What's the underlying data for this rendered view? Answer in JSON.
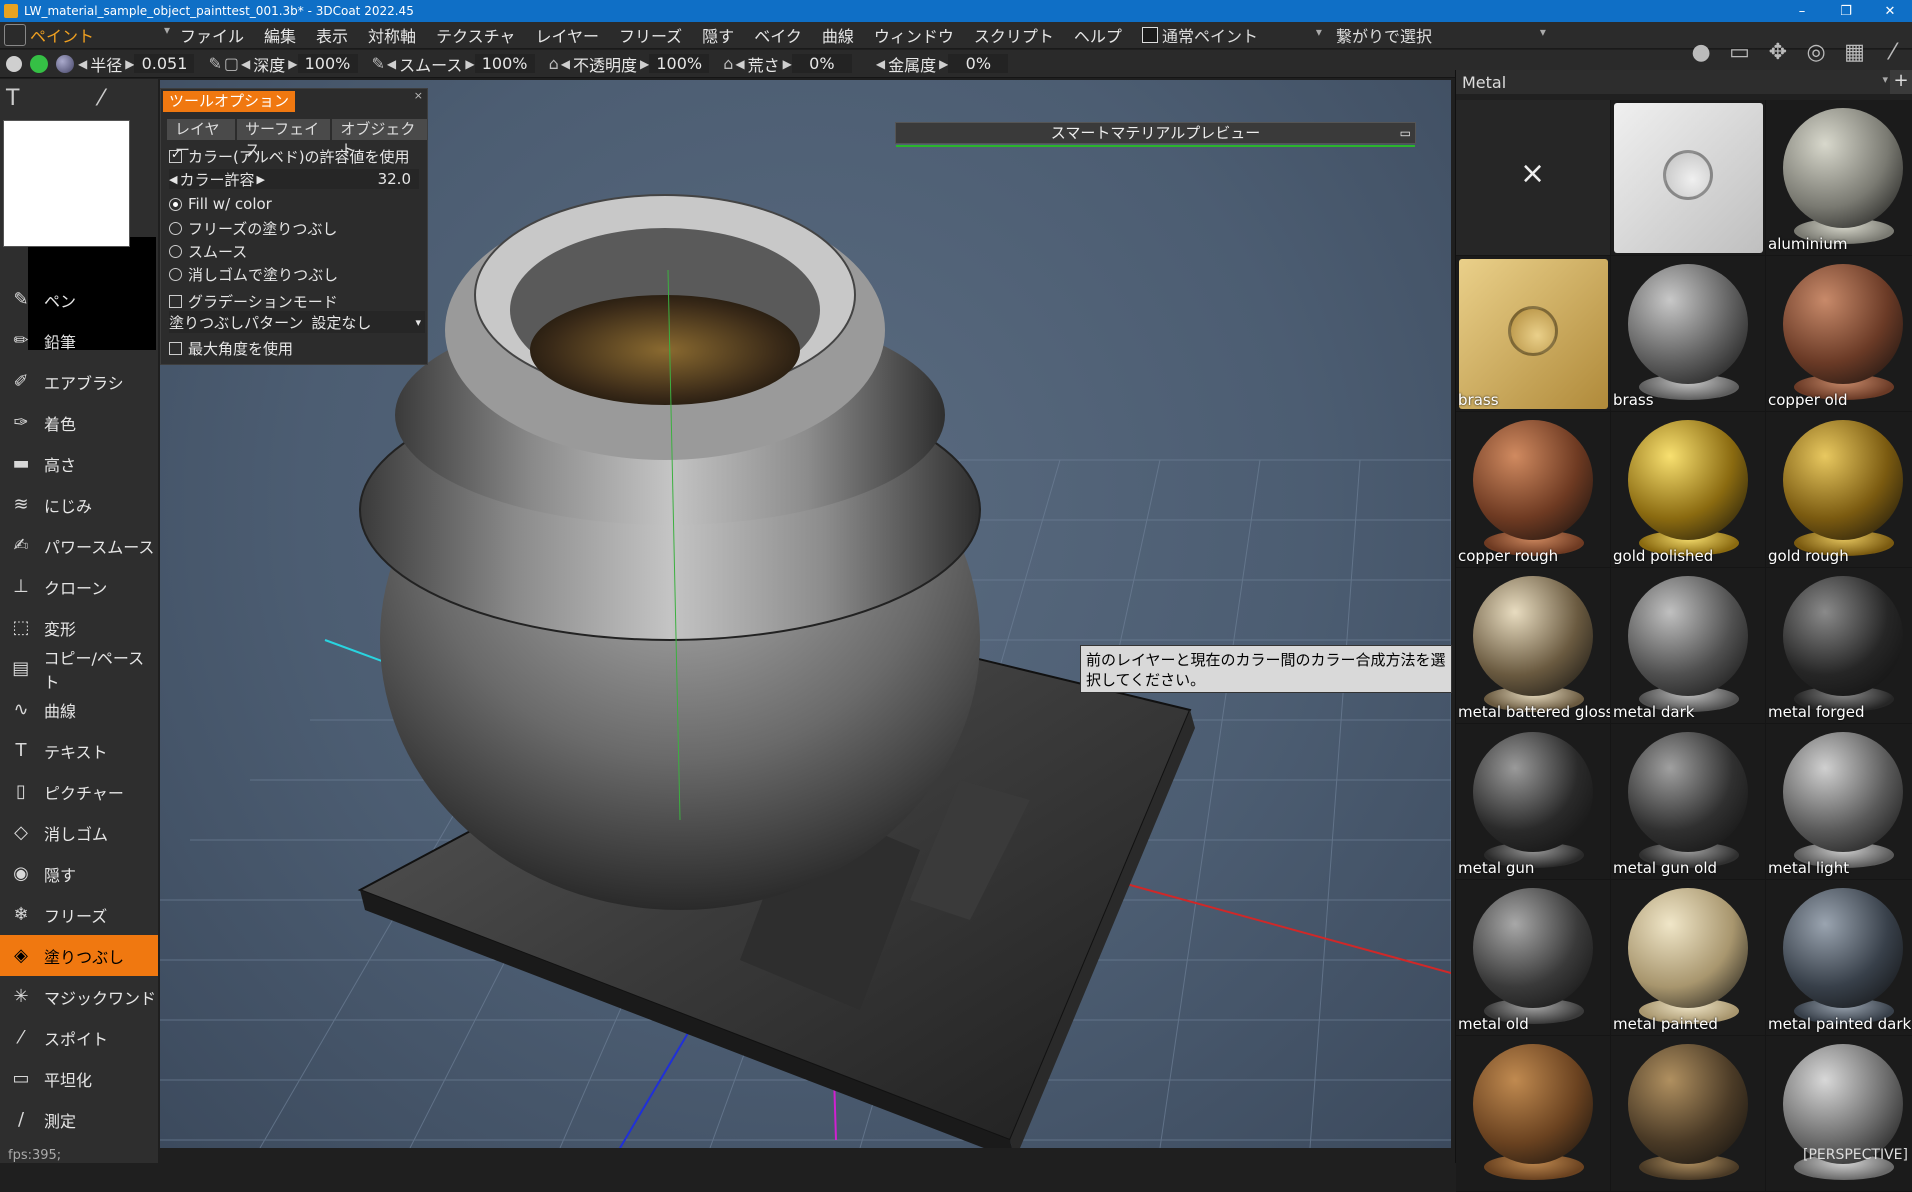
{
  "titlebar": {
    "title": "LW_material_sample_object_painttest_001.3b* - 3DCoat 2022.45",
    "minimize": "–",
    "restore": "❐",
    "close": "✕"
  },
  "menubar": {
    "room": "ペイント",
    "items": [
      "ファイル",
      "編集",
      "表示",
      "対称軸",
      "テクスチャ",
      "レイヤー",
      "フリーズ",
      "隠す",
      "ベイク",
      "曲線",
      "ウィンドウ",
      "スクリプト",
      "ヘルプ"
    ],
    "paint_mode": "通常ペイント",
    "selection_mode": "繋がりで選択"
  },
  "params": {
    "radius_label": "半径",
    "radius_value": "0.051",
    "depth_label": "深度",
    "depth_value": "100%",
    "smooth_label": "スムース",
    "smooth_value": "100%",
    "opacity_label": "不透明度",
    "opacity_value": "100%",
    "roughness_label": "荒さ",
    "roughness_value": "0%",
    "metalness_label": "金属度",
    "metalness_value": "0%"
  },
  "tools": [
    {
      "label": "ペン",
      "icon": "pen-icon",
      "glyph": "✎"
    },
    {
      "label": "鉛筆",
      "icon": "pencil-icon",
      "glyph": "✏"
    },
    {
      "label": "エアブラシ",
      "icon": "airbrush-icon",
      "glyph": "✐"
    },
    {
      "label": "着色",
      "icon": "tint-icon",
      "glyph": "✑"
    },
    {
      "label": "高さ",
      "icon": "height-icon",
      "glyph": "▬"
    },
    {
      "label": "にじみ",
      "icon": "smudge-icon",
      "glyph": "≋"
    },
    {
      "label": "パワースムース",
      "icon": "power-smooth-icon",
      "glyph": "✍"
    },
    {
      "label": "クローン",
      "icon": "clone-icon",
      "glyph": "⊥"
    },
    {
      "label": "変形",
      "icon": "transform-icon",
      "glyph": "⬚"
    },
    {
      "label": "コピー/ペースト",
      "icon": "copy-paste-icon",
      "glyph": "▤"
    },
    {
      "label": "曲線",
      "icon": "curve-icon",
      "glyph": "∿"
    },
    {
      "label": "テキスト",
      "icon": "text-icon",
      "glyph": "T"
    },
    {
      "label": "ピクチャー",
      "icon": "picture-icon",
      "glyph": "▯"
    },
    {
      "label": "消しゴム",
      "icon": "eraser-icon",
      "glyph": "◇"
    },
    {
      "label": "隠す",
      "icon": "eye-icon",
      "glyph": "◉"
    },
    {
      "label": "フリーズ",
      "icon": "snowflake-icon",
      "glyph": "❄"
    },
    {
      "label": "塗りつぶし",
      "icon": "fill-icon",
      "glyph": "◈",
      "active": true
    },
    {
      "label": "マジックワンド",
      "icon": "magic-wand-icon",
      "glyph": "✳"
    },
    {
      "label": "スポイト",
      "icon": "eyedropper-icon",
      "glyph": "⁄"
    },
    {
      "label": "平坦化",
      "icon": "flatten-icon",
      "glyph": "▭"
    },
    {
      "label": "測定",
      "icon": "measure-icon",
      "glyph": "/"
    }
  ],
  "fps": "fps:395;",
  "tooloptions": {
    "title": "ツールオプション",
    "close": "×",
    "tabs": [
      "レイヤー",
      "サーフェイス",
      "オブジェクト"
    ],
    "use_color_tolerance": "カラー(アルベド)の許容値を使用",
    "color_tolerance_label": "カラー許容",
    "color_tolerance_value": "32.0",
    "radio_fill_color": "Fill  w/  color",
    "radio_freeze_fill": "フリーズの塗りつぶし",
    "radio_smooth": "スムース",
    "radio_eraser_fill": "消しゴムで塗りつぶし",
    "gradation_mode": "グラデーションモード",
    "fill_pattern_label": "塗りつぶしパターン",
    "fill_pattern_value": "設定なし",
    "use_max_angle": "最大角度を使用"
  },
  "smartpreview": {
    "title": "スマートマテリアルプレビュー"
  },
  "tooltip": {
    "text": "前のレイヤーと現在のカラー間のカラー合成方法を選択してください。"
  },
  "materials": {
    "header": "Metal",
    "add": "+",
    "remove": "×",
    "perspective": "[PERSPECTIVE]",
    "items": [
      {
        "label": "",
        "kind": "remove"
      },
      {
        "label": "",
        "kind": "flat",
        "base": "#bfbfbf",
        "hi": "#f0f0f0"
      },
      {
        "label": "aluminium",
        "kind": "ball",
        "base": "#7a7a72",
        "hi": "#d8d8cc"
      },
      {
        "label": "brass",
        "kind": "flat",
        "base": "#b08a3a",
        "hi": "#ead08a"
      },
      {
        "label": "brass",
        "kind": "ball",
        "base": "#5e5e5e",
        "hi": "#c8c8c8"
      },
      {
        "label": "copper old",
        "kind": "ball",
        "base": "#6a3a26",
        "hi": "#c88a6a"
      },
      {
        "label": "copper rough",
        "kind": "ball",
        "base": "#6e3a22",
        "hi": "#d08a60"
      },
      {
        "label": "gold polished",
        "kind": "ball",
        "base": "#8a6a10",
        "hi": "#f8e070"
      },
      {
        "label": "gold rough",
        "kind": "ball",
        "base": "#7a5a10",
        "hi": "#e8c860"
      },
      {
        "label": "metal battered glossy",
        "kind": "ball",
        "base": "#6a5a40",
        "hi": "#e8dcc0"
      },
      {
        "label": "metal dark",
        "kind": "ball",
        "base": "#505050",
        "hi": "#c0c0c0"
      },
      {
        "label": "metal forged",
        "kind": "ball",
        "base": "#262626",
        "hi": "#8a8a8a"
      },
      {
        "label": "metal gun",
        "kind": "ball",
        "base": "#2a2a2a",
        "hi": "#9a9a9a"
      },
      {
        "label": "metal gun old",
        "kind": "ball",
        "base": "#303030",
        "hi": "#a0a0a0"
      },
      {
        "label": "metal light",
        "kind": "ball",
        "base": "#5a5a5a",
        "hi": "#d0d0d0"
      },
      {
        "label": "metal old",
        "kind": "ball",
        "base": "#3a3a3a",
        "hi": "#a8a8a8"
      },
      {
        "label": "metal painted",
        "kind": "ball",
        "base": "#a8966e",
        "hi": "#f0e6c8"
      },
      {
        "label": "metal painted dark",
        "kind": "ball",
        "base": "#38404a",
        "hi": "#9aa4b0"
      },
      {
        "label": "",
        "kind": "ball",
        "base": "#6a4220",
        "hi": "#c08a50"
      },
      {
        "label": "",
        "kind": "ball",
        "base": "#4a3a26",
        "hi": "#b09060"
      },
      {
        "label": "",
        "kind": "ball",
        "base": "#6a6a6a",
        "hi": "#d8d8d8"
      }
    ]
  }
}
